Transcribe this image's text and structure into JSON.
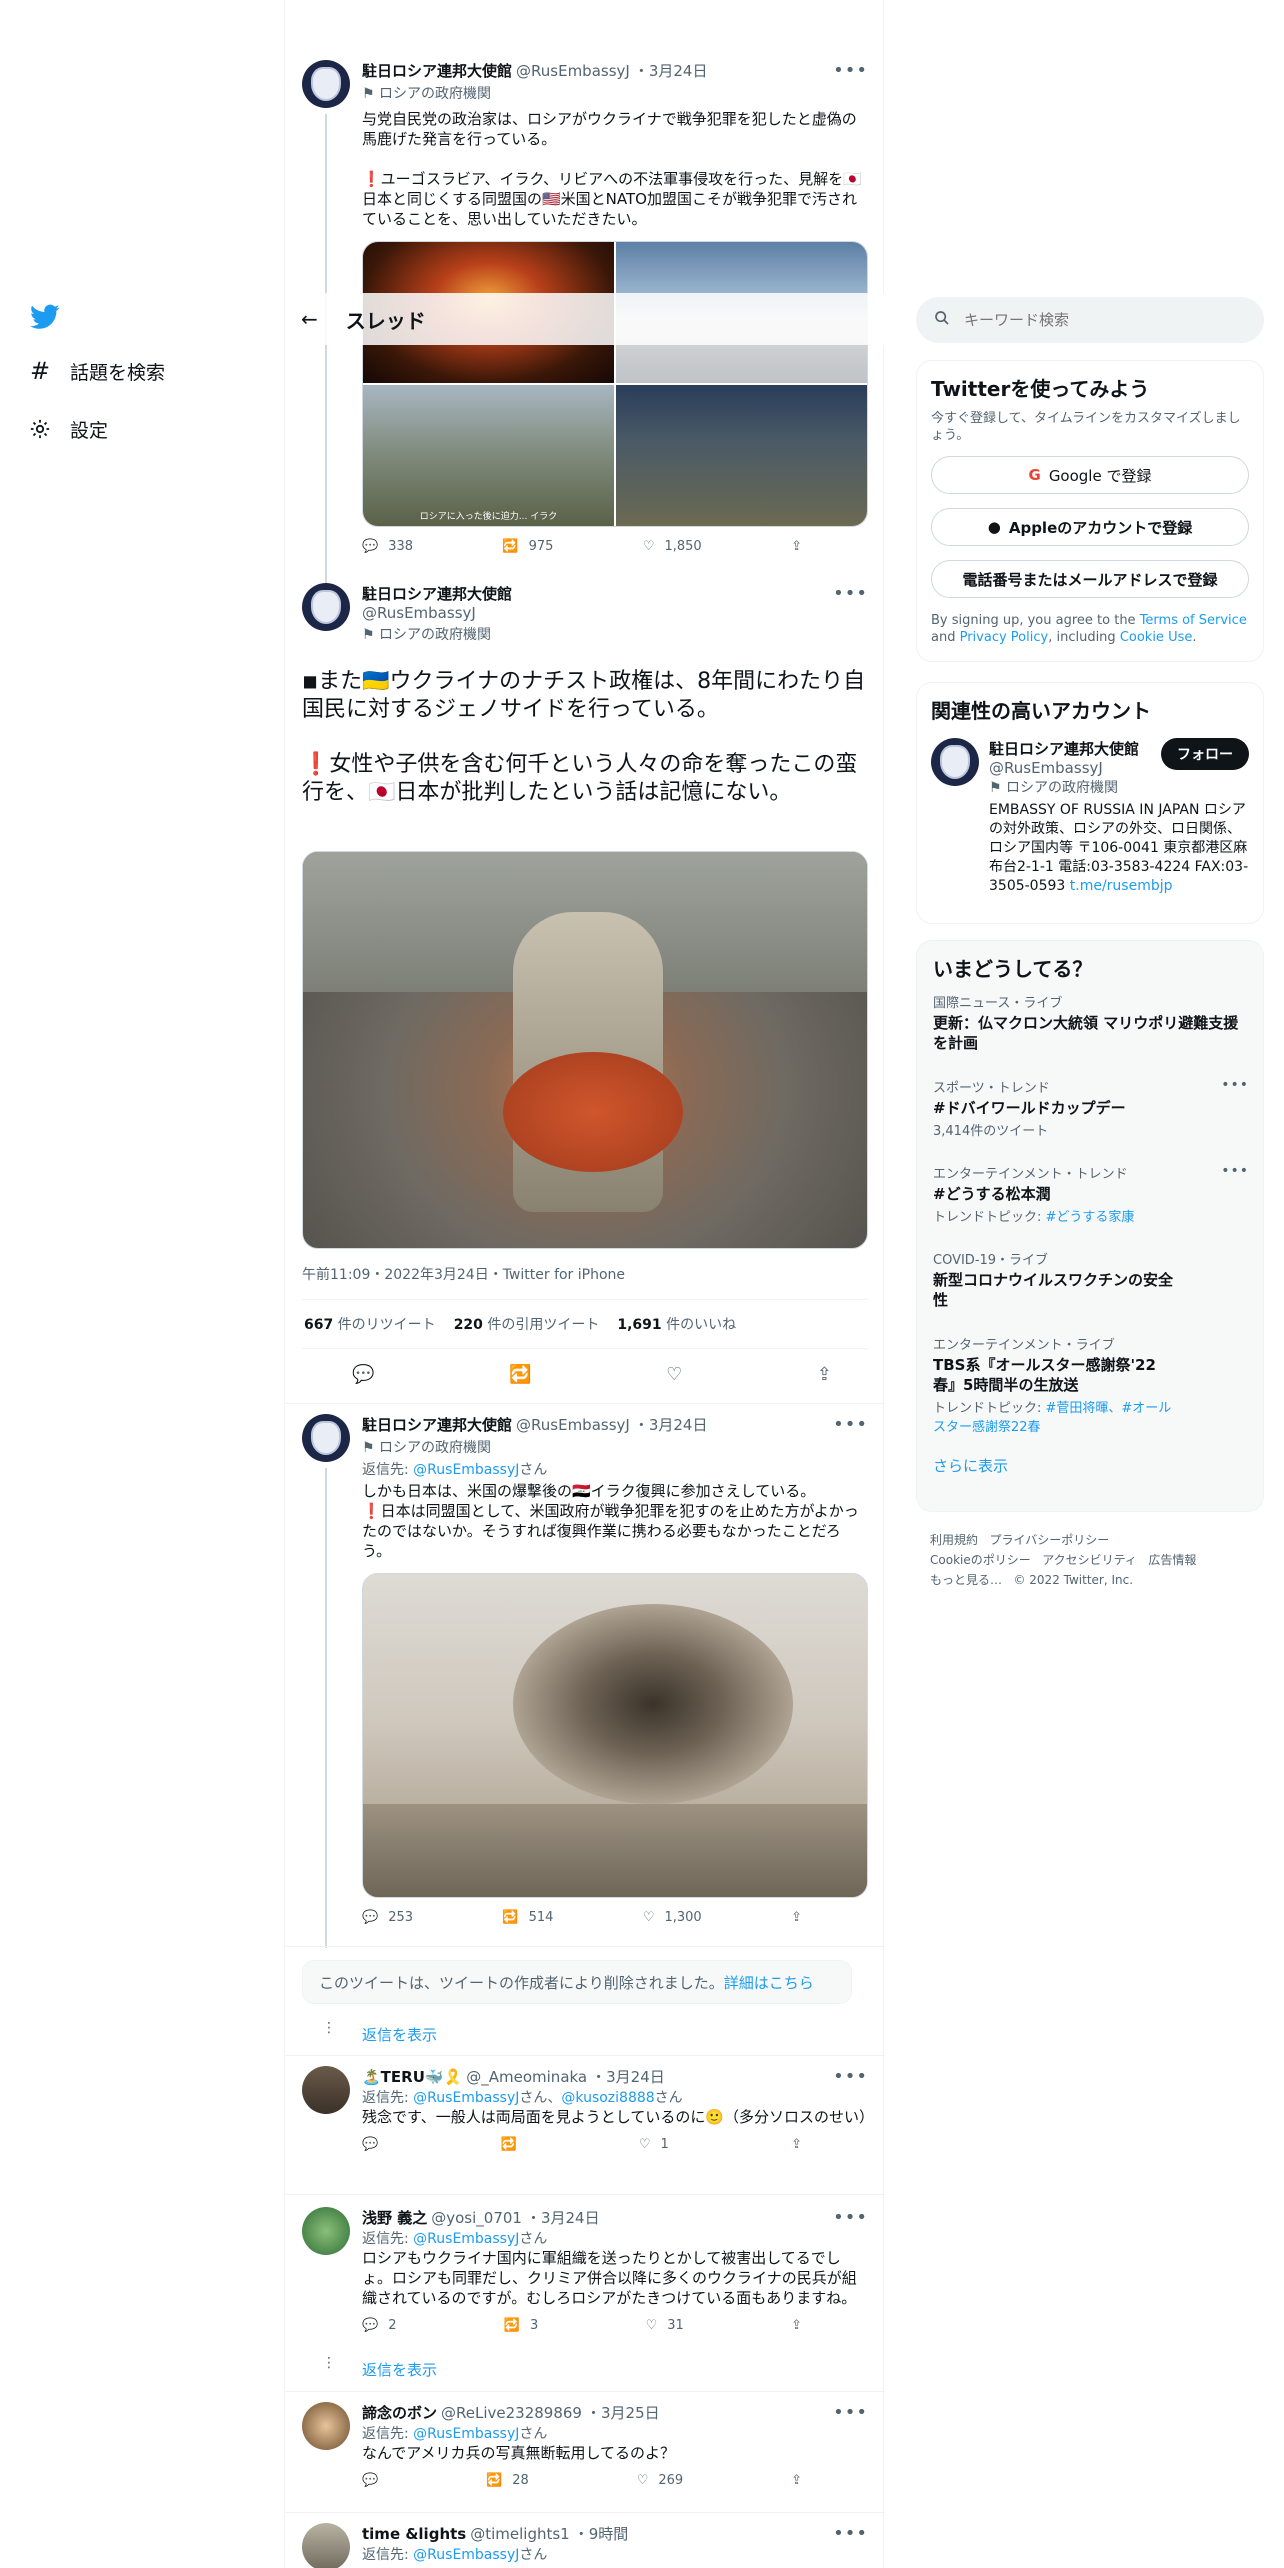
{
  "nav": {
    "search_label": "話題を検索",
    "settings_label": "設定"
  },
  "header": {
    "title": "スレッド"
  },
  "search": {
    "placeholder": "キーワード検索"
  },
  "tweet1": {
    "name": "駐日ロシア連邦大使館",
    "handle": "@RusEmbassyJ",
    "date": "・3月24日",
    "label": "ロシアの政府機関",
    "text1": "与党自民党の政治家は、ロシアがウクライナで戦争犯罪を犯したと虚偽の馬鹿げた発言を行っている。",
    "text2": "❗ユーゴスラビア、イラク、リビアへの不法軍事侵攻を行った、見解を🇯🇵日本と同じくする同盟国の🇺🇸米国とNATO加盟国こそが戦争犯罪で汚されていることを、思い出していただきたい。",
    "image_caption": "ロシアに入った後に迫力... イラク",
    "replies": "338",
    "retweets": "975",
    "likes": "1,850"
  },
  "tweet2": {
    "name": "駐日ロシア連邦大使館",
    "handle": "@RusEmbassyJ",
    "label": "ロシアの政府機関",
    "text1": "◾また🇺🇦ウクライナのナチスト政権は、8年間にわたり自国民に対するジェノサイドを行っている。",
    "text2": "❗女性や子供を含む何千という人々の命を奪ったこの蛮行を、🇯🇵日本が批判したという話は記憶にない。",
    "timestamp": "午前11:09・2022年3月24日・Twitter for iPhone",
    "rt_count": "667",
    "rt_label": "件のリツイート",
    "qt_count": "220",
    "qt_label": "件の引用ツイート",
    "like_count": "1,691",
    "like_label": "件のいいね"
  },
  "tweet3": {
    "name": "駐日ロシア連邦大使館",
    "handle": "@RusEmbassyJ",
    "date": "・3月24日",
    "label": "ロシアの政府機関",
    "reply_prefix": "返信先: ",
    "reply_to": "@RusEmbassyJ",
    "reply_suffix": "さん",
    "text": "しかも日本は、米国の爆撃後の🇮🇶イラク復興に参加さえしている。\n❗日本は同盟国として、米国政府が戦争犯罪を犯すのを止めた方がよかったのではないか。そうすれば復興作業に携わる必要もなかったことだろう。",
    "replies": "253",
    "retweets": "514",
    "likes": "1,300"
  },
  "deleted": {
    "text": "このツイートは、ツイートの作成者により削除されました。",
    "link": "詳細はこちら",
    "show_replies": "返信を表示"
  },
  "reply1": {
    "name": "🏝️TERU🐳🎗️",
    "handle": "@_Ameominaka",
    "date": "・3月24日",
    "reply_prefix": "返信先: ",
    "reply_to": "@RusEmbassyJ",
    "reply_mid": "さん、",
    "reply_to2": "@kusozi8888",
    "reply_suffix": "さん",
    "text": "残念です、一般人は両局面を見ようとしているのに🙂（多分ソロスのせい）",
    "likes": "1"
  },
  "reply2": {
    "name": "浅野 義之",
    "handle": "@yosi_0701",
    "date": "・3月24日",
    "reply_prefix": "返信先: ",
    "reply_to": "@RusEmbassyJ",
    "reply_suffix": "さん",
    "text": "ロシアもウクライナ国内に軍組織を送ったりとかして被害出してるでしょ。ロシアも同罪だし、クリミア併合以降に多くのウクライナの民兵が組織されているのですが。むしろロシアがたきつけている面もありますね。",
    "replies": "2",
    "retweets": "3",
    "likes": "31",
    "show_replies": "返信を表示"
  },
  "reply3": {
    "name": "諦念のボン",
    "handle": "@ReLive23289869",
    "date": "・3月25日",
    "reply_prefix": "返信先: ",
    "reply_to": "@RusEmbassyJ",
    "reply_suffix": "さん",
    "text": "なんでアメリカ兵の写真無断転用してるのよ？",
    "retweets": "28",
    "likes": "269"
  },
  "reply4": {
    "name": "time &lights",
    "handle": "@timelights1",
    "date": "・9時間",
    "reply_prefix": "返信先: ",
    "reply_to": "@RusEmbassyJ",
    "reply_suffix": "さん"
  },
  "signup": {
    "title": "Twitterを使ってみよう",
    "subtitle": "今すぐ登録して、タイムラインをカスタマイズしましょう。",
    "google": "Google で登録",
    "apple": "Appleのアカウントで登録",
    "phone": "電話番号またはメールアドレスで登録",
    "terms_pre": "By signing up, you agree to the ",
    "terms": "Terms of Service",
    "terms_and": " and ",
    "privacy": "Privacy Policy",
    "terms_inc": ", including ",
    "cookie": "Cookie Use",
    "terms_end": "."
  },
  "related": {
    "title": "関連性の高いアカウント",
    "name": "駐日ロシア連邦大使館",
    "handle": "@RusEmbassyJ",
    "follow": "フォロー",
    "label": "ロシアの政府機関",
    "bio": "EMBASSY OF RUSSIA IN JAPAN ロシアの対外政策、ロシアの外交、ロ日関係、ロシア国内等 〒106-0041 東京都港区麻布台2-1-1 電話:03-3583-4224 FAX:03-3505-0593 ",
    "bio_link": "t.me/rusembjp"
  },
  "trends": {
    "title": "いまどうしてる？",
    "items": [
      {
        "meta": "国際ニュース・ライブ",
        "title": "更新：仏マクロン大統領 マリウポリ避難支援を計画"
      },
      {
        "meta": "スポーツ・トレンド",
        "title": "#ドバイワールドカップデー",
        "sub": "3,414件のツイート"
      },
      {
        "meta": "エンターテインメント・トレンド",
        "title": "#どうする松本潤",
        "sub_pre": "トレンドトピック: ",
        "sub_link": "#どうする家康"
      },
      {
        "meta": "COVID-19・ライブ",
        "title": "新型コロナウイルスワクチンの安全性"
      },
      {
        "meta": "エンターテインメント・ライブ",
        "title": "TBS系『オールスター感謝祭'22春』5時間半の生放送",
        "sub_pre": "トレンドトピック: ",
        "sub_link": "#菅田将暉、#オールスター感謝祭22春"
      }
    ],
    "more": "さらに表示"
  },
  "footer": {
    "l1": "利用規約",
    "l2": "プライバシーポリシー",
    "l3": "Cookieのポリシー",
    "l4": "アクセシビリティ",
    "l5": "広告情報",
    "l6": "もっと見る…",
    "copy": "© 2022 Twitter, Inc."
  },
  "colors": {
    "accent": "#1d9bf0",
    "text": "#0f1419",
    "muted": "#536471"
  }
}
